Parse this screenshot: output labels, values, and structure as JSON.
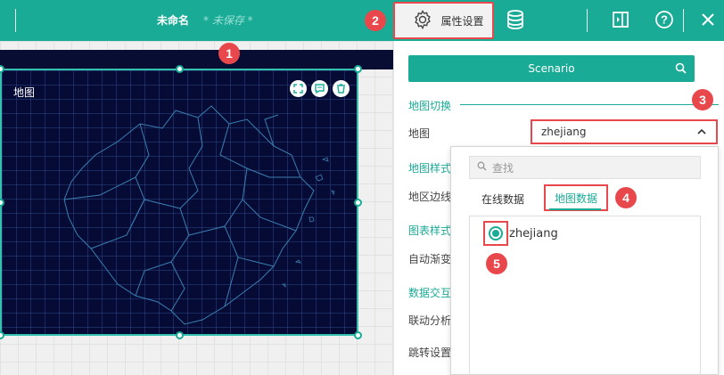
{
  "header": {
    "title": "未命名",
    "unsaved": "* 未保存 *",
    "attr_settings_label": "属性设置",
    "icons": [
      "gear-icon",
      "database-icon",
      "panel-toggle-icon",
      "help-icon",
      "close-icon"
    ]
  },
  "canvas": {
    "widget_title": "地图",
    "widget_icons": [
      "fullscreen-icon",
      "comment-icon",
      "delete-icon"
    ]
  },
  "callouts": [
    "1",
    "2",
    "3",
    "4",
    "5"
  ],
  "panel": {
    "scenario_label": "Scenario",
    "sections": {
      "map_switch": "地图切换",
      "map_style": "地图样式",
      "chart_style": "图表样式",
      "data_interaction": "数据交互"
    },
    "rows": {
      "map": "地图",
      "region_border": "地区边线",
      "auto_gradient": "自动渐变",
      "linked_analysis": "联动分析",
      "jump_settings": "跳转设置"
    },
    "map_select_value": "zhejiang"
  },
  "dropdown": {
    "search_placeholder": "查找",
    "tabs": [
      "在线数据",
      "地图数据"
    ],
    "active_tab": "地图数据",
    "options": [
      "zhejiang"
    ],
    "selected": "zhejiang"
  },
  "colors": {
    "accent": "#1aab97",
    "callout": "#e8474b",
    "map_bg": "#050b35"
  }
}
